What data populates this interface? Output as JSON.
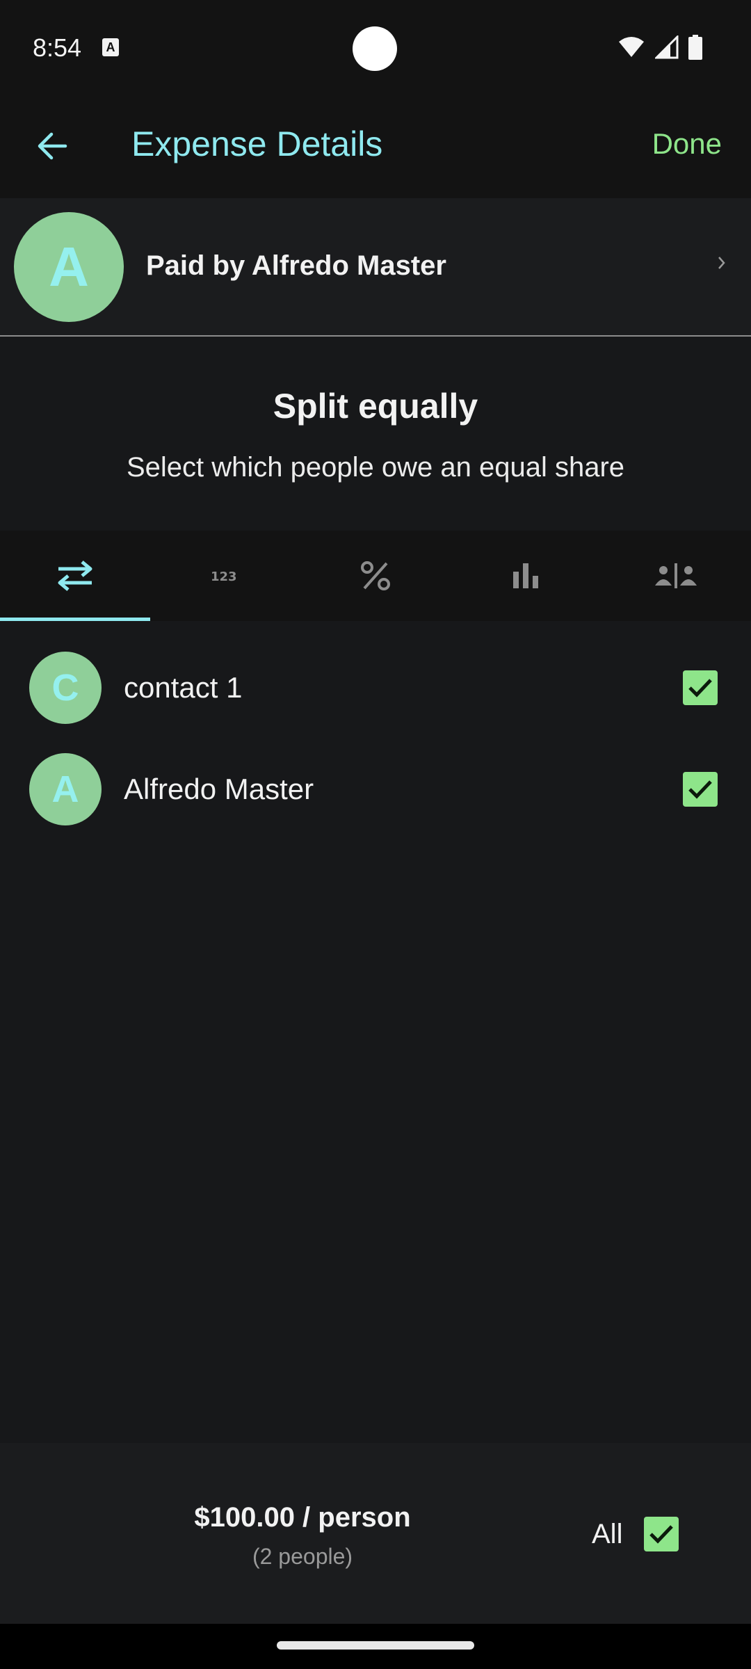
{
  "status_bar": {
    "time": "8:54",
    "notification_icon": "text-a-icon",
    "icons": [
      "wifi-icon",
      "signal-icon",
      "battery-icon"
    ]
  },
  "app_bar": {
    "back_icon": "arrow-back-icon",
    "title": "Expense Details",
    "done_label": "Done"
  },
  "paid_by": {
    "avatar_letter": "A",
    "text": "Paid by Alfredo Master",
    "chevron_icon": "chevron-right-icon"
  },
  "split": {
    "title": "Split equally",
    "subtitle": "Select which people owe an equal share"
  },
  "tabs": [
    {
      "icon": "swap-arrows-icon",
      "selected": true
    },
    {
      "icon": "numbers-123-icon",
      "selected": false
    },
    {
      "icon": "percent-icon",
      "selected": false
    },
    {
      "icon": "bar-chart-icon",
      "selected": false
    },
    {
      "icon": "people-split-icon",
      "selected": false
    }
  ],
  "people": [
    {
      "letter": "C",
      "name": "contact 1",
      "checked": true
    },
    {
      "letter": "A",
      "name": "Alfredo Master",
      "checked": true
    }
  ],
  "summary": {
    "per_person": "$100.00 / person",
    "people_count": "(2 people)",
    "all_label": "All",
    "all_checked": true
  },
  "colors": {
    "accent": "#8fe9ef",
    "done_green": "#8ee58a",
    "avatar_bg": "#8fcf99",
    "background": "#17181a"
  }
}
